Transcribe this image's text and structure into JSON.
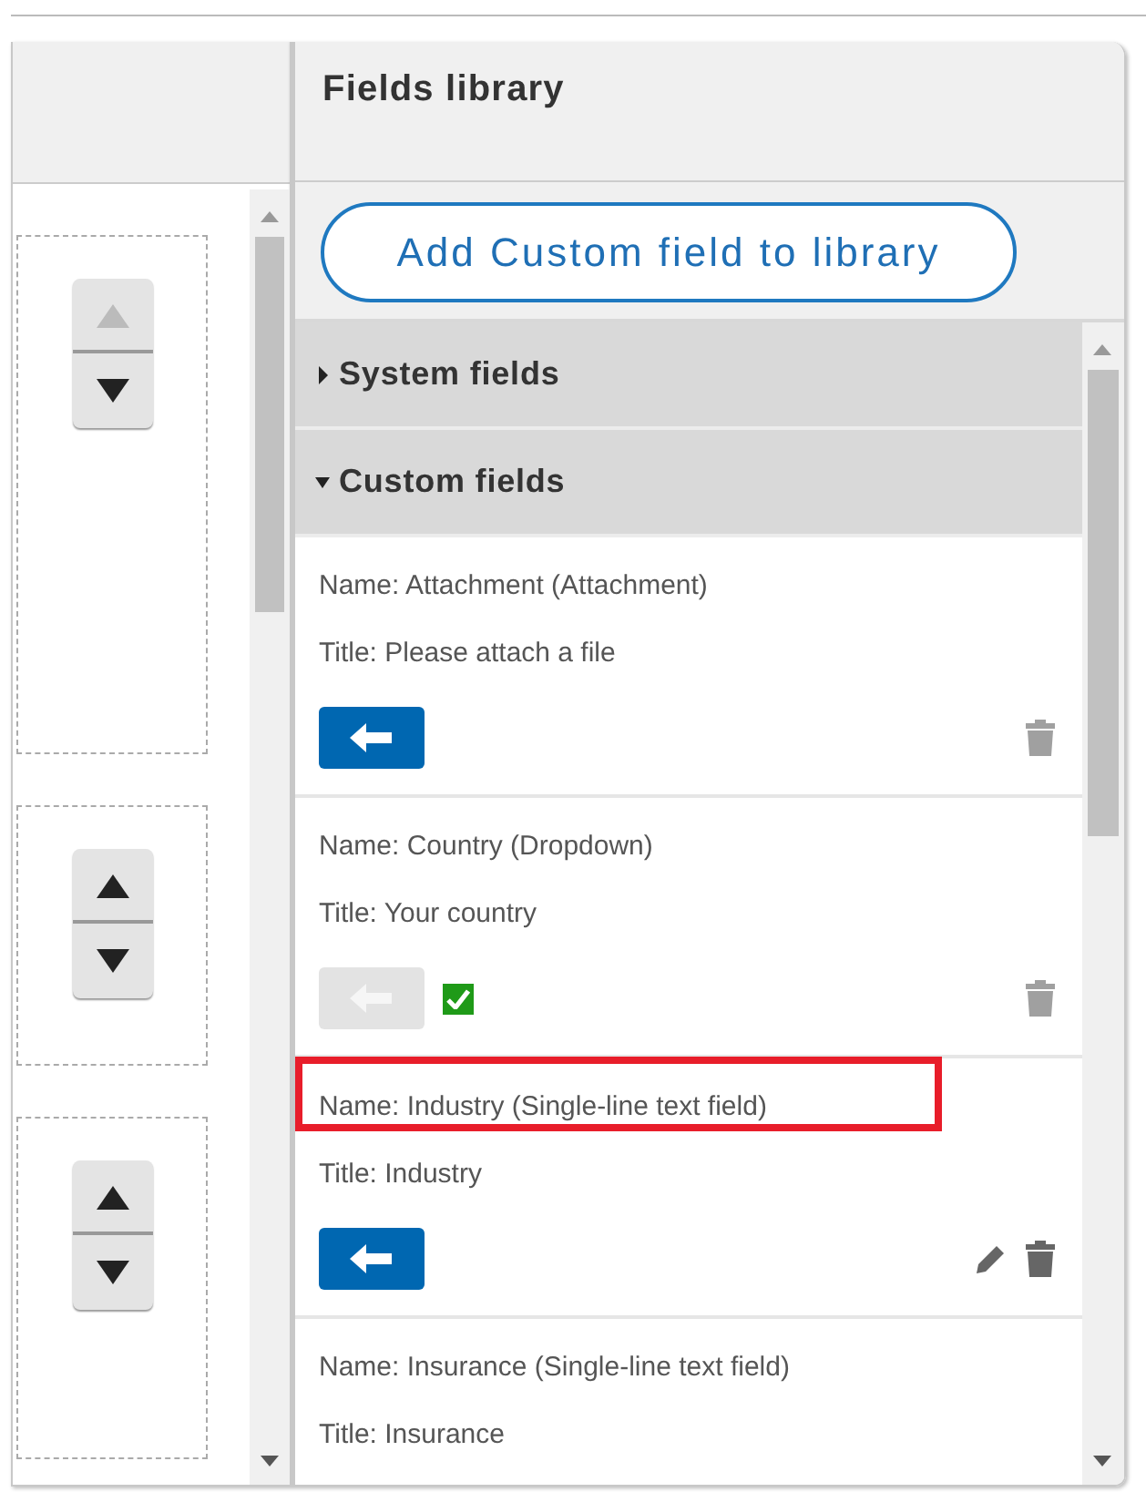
{
  "form_area": {
    "slots": [
      {
        "up_disabled": true,
        "down_disabled": false
      },
      {
        "up_disabled": false,
        "down_disabled": false
      },
      {
        "up_disabled": false,
        "down_disabled": false
      }
    ]
  },
  "fields_library": {
    "title": "Fields library",
    "add_button": "Add Custom field to library",
    "sections": [
      {
        "label": "System fields",
        "expanded": false
      },
      {
        "label": "Custom fields",
        "expanded": true,
        "children": [
          {
            "name": "Name: Attachment (Attachment)",
            "title": "Title: Please attach a file",
            "highlighted": false,
            "actions": {
              "add_enabled": true,
              "in_form": false,
              "editable": false,
              "deletable": true
            }
          },
          {
            "name": "Name: Country (Dropdown)",
            "title": "Title: Your country",
            "highlighted": false,
            "actions": {
              "add_enabled": false,
              "in_form": true,
              "editable": false,
              "deletable": true
            }
          },
          {
            "name": "Name: Industry (Single-line text field)",
            "title": "Title: Industry",
            "highlighted": true,
            "actions": {
              "add_enabled": true,
              "in_form": false,
              "editable": true,
              "deletable": true
            }
          },
          {
            "name": "Name: Insurance (Single-line text field)",
            "title": "Title: Insurance",
            "highlighted": false
          }
        ]
      }
    ]
  }
}
